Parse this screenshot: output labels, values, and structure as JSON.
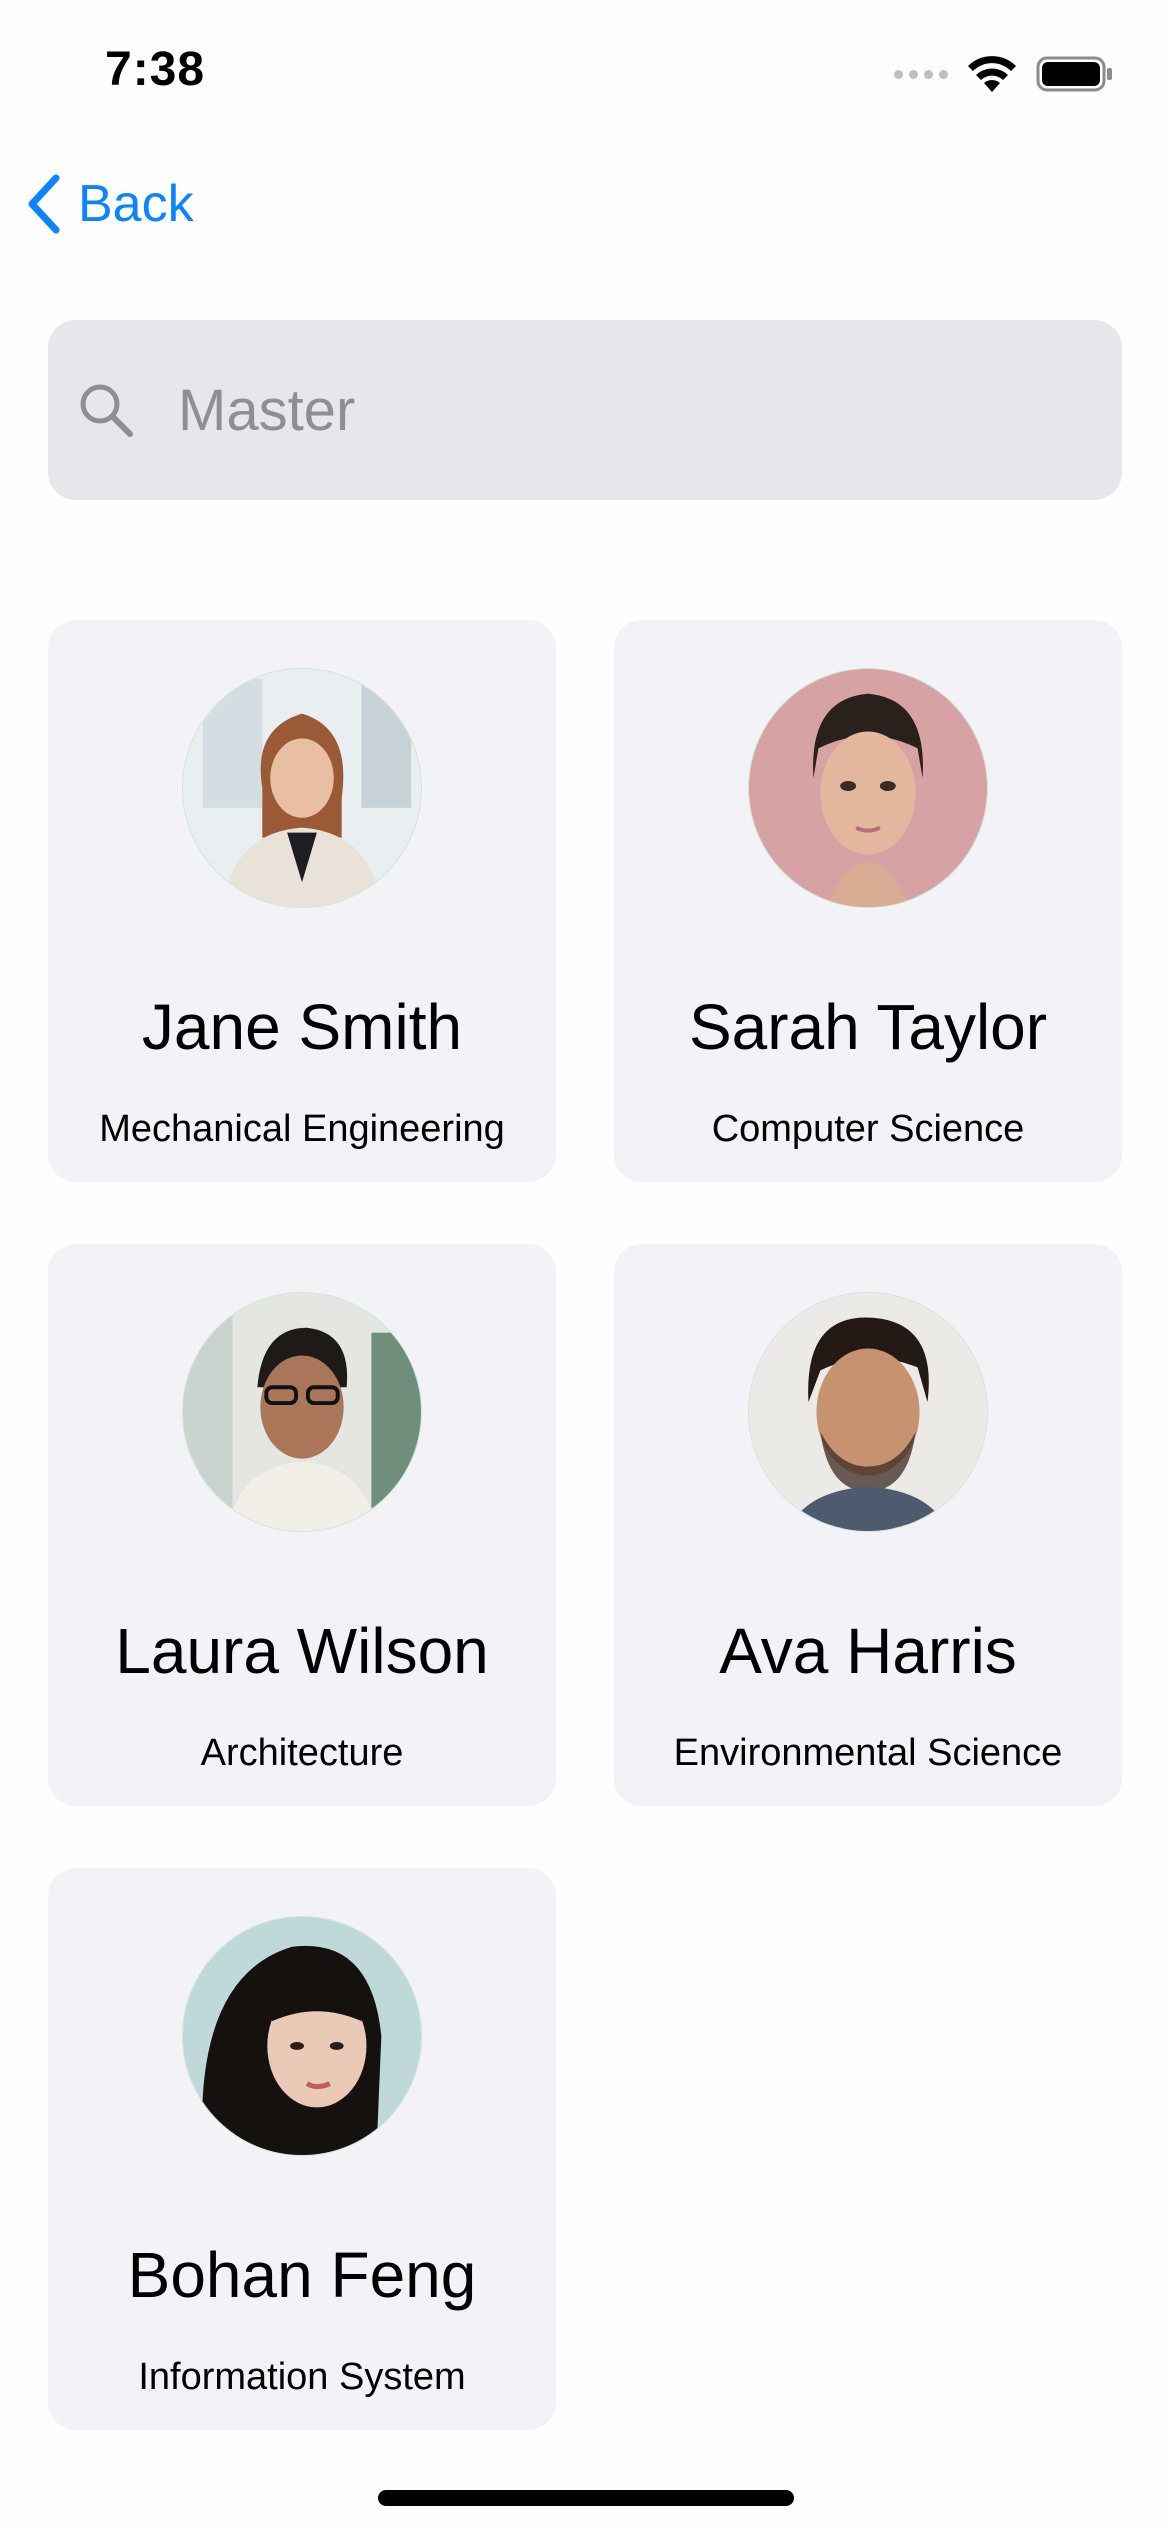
{
  "status_bar": {
    "time": "7:38"
  },
  "nav": {
    "back_label": "Back",
    "accent": "#0A84FF"
  },
  "search": {
    "placeholder": "Master",
    "value": ""
  },
  "people": [
    {
      "name": "Jane Smith",
      "department": "Mechanical Engineering"
    },
    {
      "name": "Sarah Taylor",
      "department": "Computer Science"
    },
    {
      "name": "Laura Wilson",
      "department": "Architecture"
    },
    {
      "name": "Ava Harris",
      "department": "Environmental Science"
    },
    {
      "name": "Bohan Feng",
      "department": "Information System"
    }
  ],
  "colors": {
    "card_background": "#F2F2F7",
    "search_background": "#E6E6EB",
    "placeholder": "#8E8E93"
  },
  "icons": {
    "back": "chevron-left-icon",
    "search": "magnifying-glass-icon",
    "signal": "cellular-signal-icon",
    "wifi": "wifi-icon",
    "battery": "battery-icon"
  }
}
